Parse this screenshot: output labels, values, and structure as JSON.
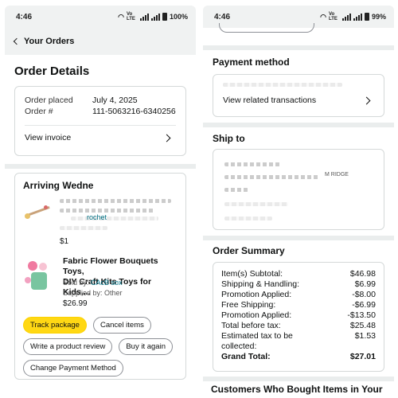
{
  "status_left": {
    "time": "4:46",
    "net": "Vo LTE",
    "battery": "100%"
  },
  "status_right": {
    "time": "4:46",
    "net": "Vo LTE",
    "battery": "99%"
  },
  "nav": {
    "back_label": "Your Orders"
  },
  "order_details": {
    "title": "Order Details",
    "placed_label": "Order placed",
    "placed_value": "July 4, 2025",
    "number_label": "Order #",
    "number_value": "111-5063216-6340256",
    "invoice_label": "View invoice"
  },
  "shipment": {
    "arriving": "Arriving Wedne",
    "item1": {
      "price_partial": "$1",
      "link_fragment": "rochet"
    },
    "item2": {
      "title_line1": "Fabric Flower Bouquets Toys,",
      "title_line2": "DIY Craft Kits Toys for Kids,...",
      "sold_by_label": "Sold by:",
      "seller": "CAcB sox",
      "supplied_by": "Supplied by: Other",
      "price": "$26.99"
    },
    "buttons": {
      "track": "Track package",
      "cancel": "Cancel items",
      "review": "Write a product review",
      "buy_again": "Buy it again",
      "change_payment": "Change Payment Method"
    }
  },
  "payment": {
    "title": "Payment method",
    "transactions_label": "View related transactions"
  },
  "ship_to": {
    "title": "Ship to",
    "visible_fragment": "M RIDGE"
  },
  "summary": {
    "title": "Order Summary",
    "rows": [
      {
        "label": "Item(s) Subtotal:",
        "value": "$46.98"
      },
      {
        "label": "Shipping & Handling:",
        "value": "$6.99"
      },
      {
        "label": "Promotion Applied:",
        "value": "-$8.00"
      },
      {
        "label": "Free Shipping:",
        "value": "-$6.99"
      },
      {
        "label": "Promotion Applied:",
        "value": "-$13.50"
      },
      {
        "label": "Total before tax:",
        "value": "$25.48"
      }
    ],
    "tax_label_1": "Estimated tax to be",
    "tax_label_2": "collected:",
    "tax_value": "$1.53",
    "grand_label": "Grand Total:",
    "grand_value": "$27.01"
  },
  "customers_heading": "Customers Who Bought Items in Your",
  "colors": {
    "track_button": "#ffd814",
    "link": "#007185",
    "header_bg": "#f0f2f2"
  }
}
